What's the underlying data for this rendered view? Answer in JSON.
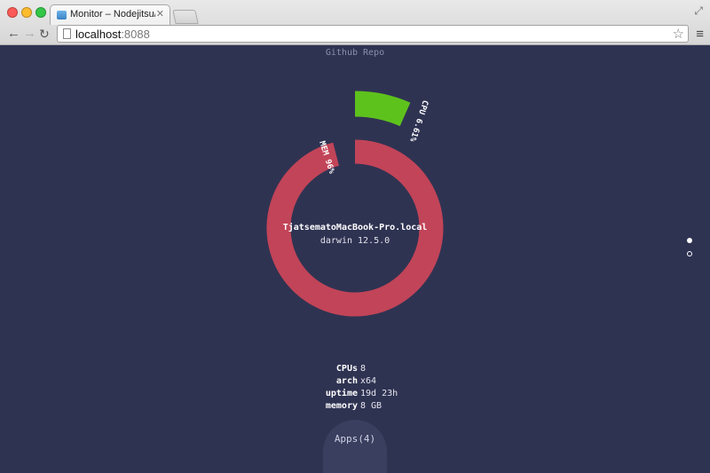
{
  "browser": {
    "tab_title": "Monitor – Nodejitsu/forever",
    "url_host": "localhost",
    "url_port": ":8088"
  },
  "page": {
    "repo_link": "Github Repo",
    "hostname": "TjatsematoMacBook-Pro.local",
    "os": "darwin 12.5.0",
    "cpu_label": "CPU 6.61%",
    "mem_label": "MEM 96%",
    "cpu_percent": 6.61,
    "mem_percent": 96,
    "colors": {
      "background": "#2f3352",
      "cpu": "#5ec21d",
      "mem": "#c24458"
    },
    "stats": [
      {
        "key": "CPUs",
        "value": "8"
      },
      {
        "key": "arch",
        "value": "x64"
      },
      {
        "key": "uptime",
        "value": "19d 23h"
      },
      {
        "key": "memory",
        "value": "8 GB"
      }
    ],
    "apps_label": "Apps",
    "apps_count": "(4)"
  }
}
